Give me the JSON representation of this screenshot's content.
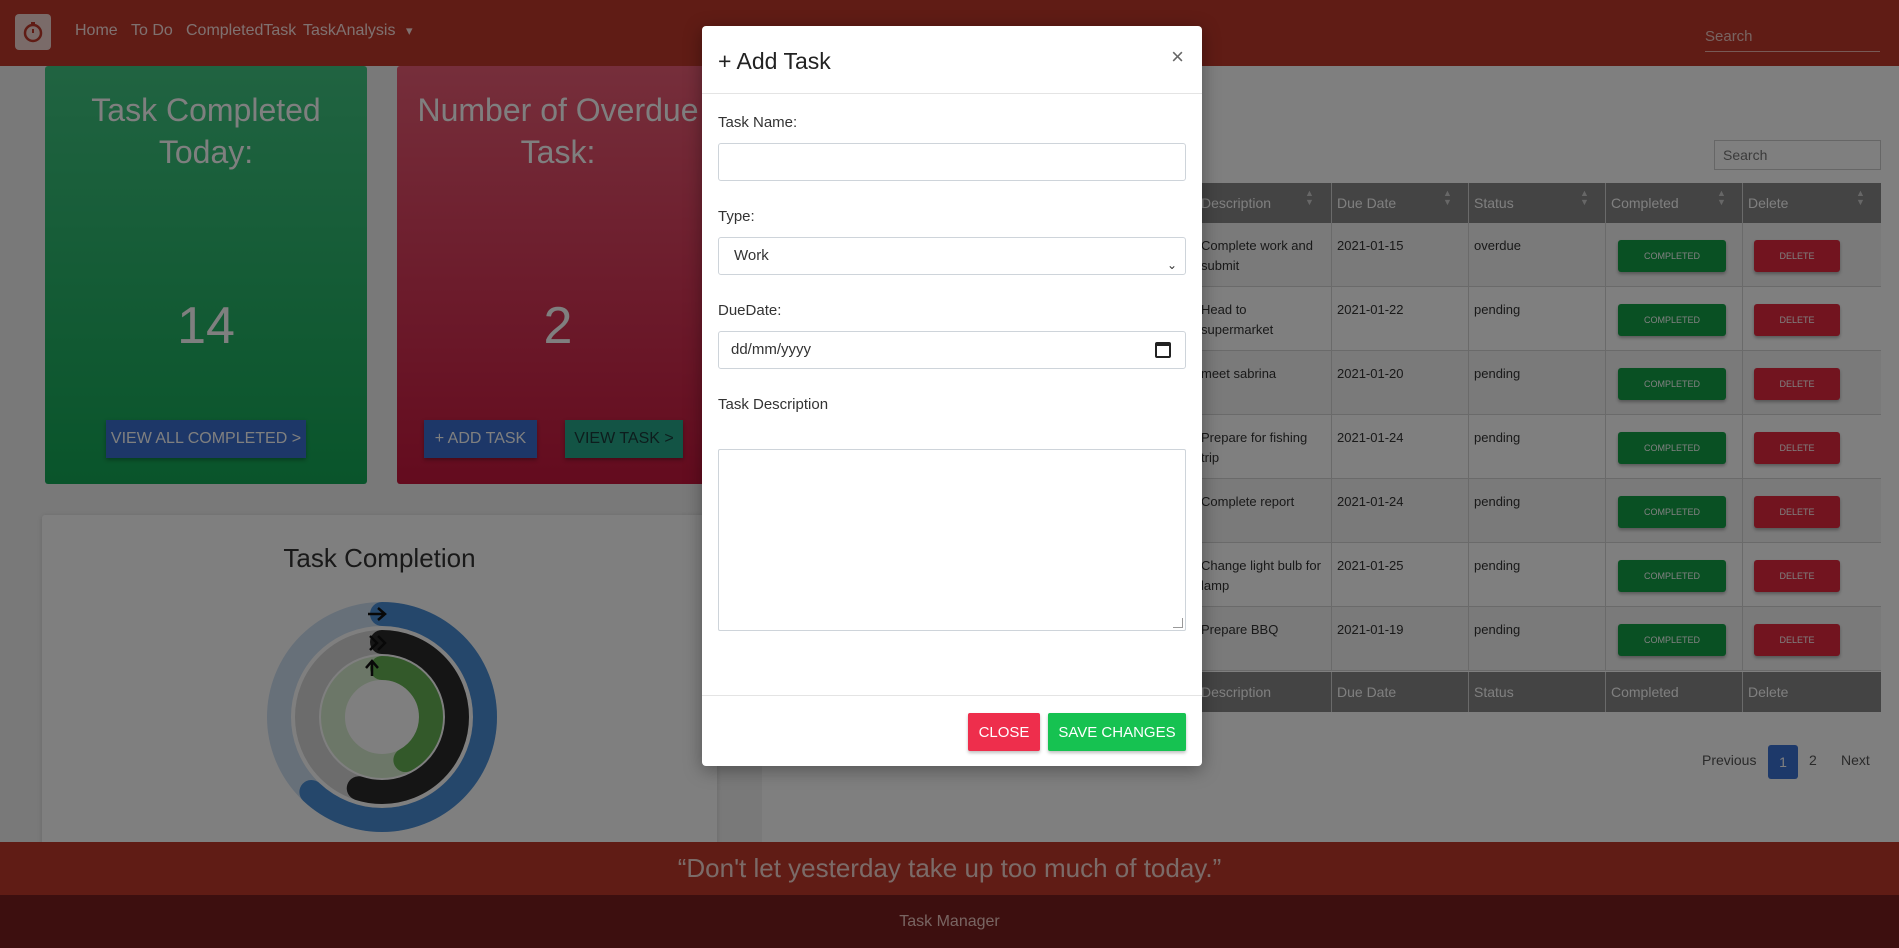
{
  "navbar": {
    "links": [
      "Home",
      "To Do",
      "CompletedTask",
      "TaskAnalysis"
    ],
    "dropdown_caret": "▾",
    "search_placeholder": "Search"
  },
  "cards": {
    "completed": {
      "title": "Task Completed Today:",
      "count": "14",
      "button": "VIEW ALL COMPLETED >"
    },
    "overdue": {
      "title": "Number of Overdue Task:",
      "count": "2",
      "add_button": "+ ADD TASK",
      "view_button": "VIEW TASK >"
    }
  },
  "completion": {
    "title": "Task Completion",
    "ring_levels": [
      0.62,
      0.55,
      0.42
    ]
  },
  "table": {
    "search_placeholder": "Search",
    "headers": [
      "Description",
      "Due Date",
      "Status",
      "Completed",
      "Delete"
    ],
    "completed_label": "COMPLETED",
    "delete_label": "DELETE",
    "rows": [
      {
        "description": "Complete work and submit",
        "due": "2021-01-15",
        "status": "overdue"
      },
      {
        "description": "Head to supermarket",
        "due": "2021-01-22",
        "status": "pending"
      },
      {
        "description": "meet sabrina",
        "due": "2021-01-20",
        "status": "pending"
      },
      {
        "description": "Prepare for fishing trip",
        "due": "2021-01-24",
        "status": "pending"
      },
      {
        "description": "Complete report",
        "due": "2021-01-24",
        "status": "pending"
      },
      {
        "description": "Change light bulb for lamp",
        "due": "2021-01-25",
        "status": "pending"
      },
      {
        "description": "Prepare BBQ",
        "due": "2021-01-19",
        "status": "pending"
      }
    ],
    "pagination": {
      "previous": "Previous",
      "pages": [
        "1",
        "2"
      ],
      "next": "Next"
    }
  },
  "quote": "“Don't let yesterday take up too much of today.”",
  "footer": "Task Manager",
  "modal": {
    "title": "+ Add Task",
    "close_symbol": "×",
    "task_name_label": "Task Name:",
    "task_name_value": "",
    "type_label": "Type:",
    "type_value": "Work",
    "due_label": "DueDate:",
    "due_placeholder": "dd/mm/yyyy",
    "desc_label": "Task Description",
    "close_button": "CLOSE",
    "save_button": "SAVE CHANGES"
  }
}
